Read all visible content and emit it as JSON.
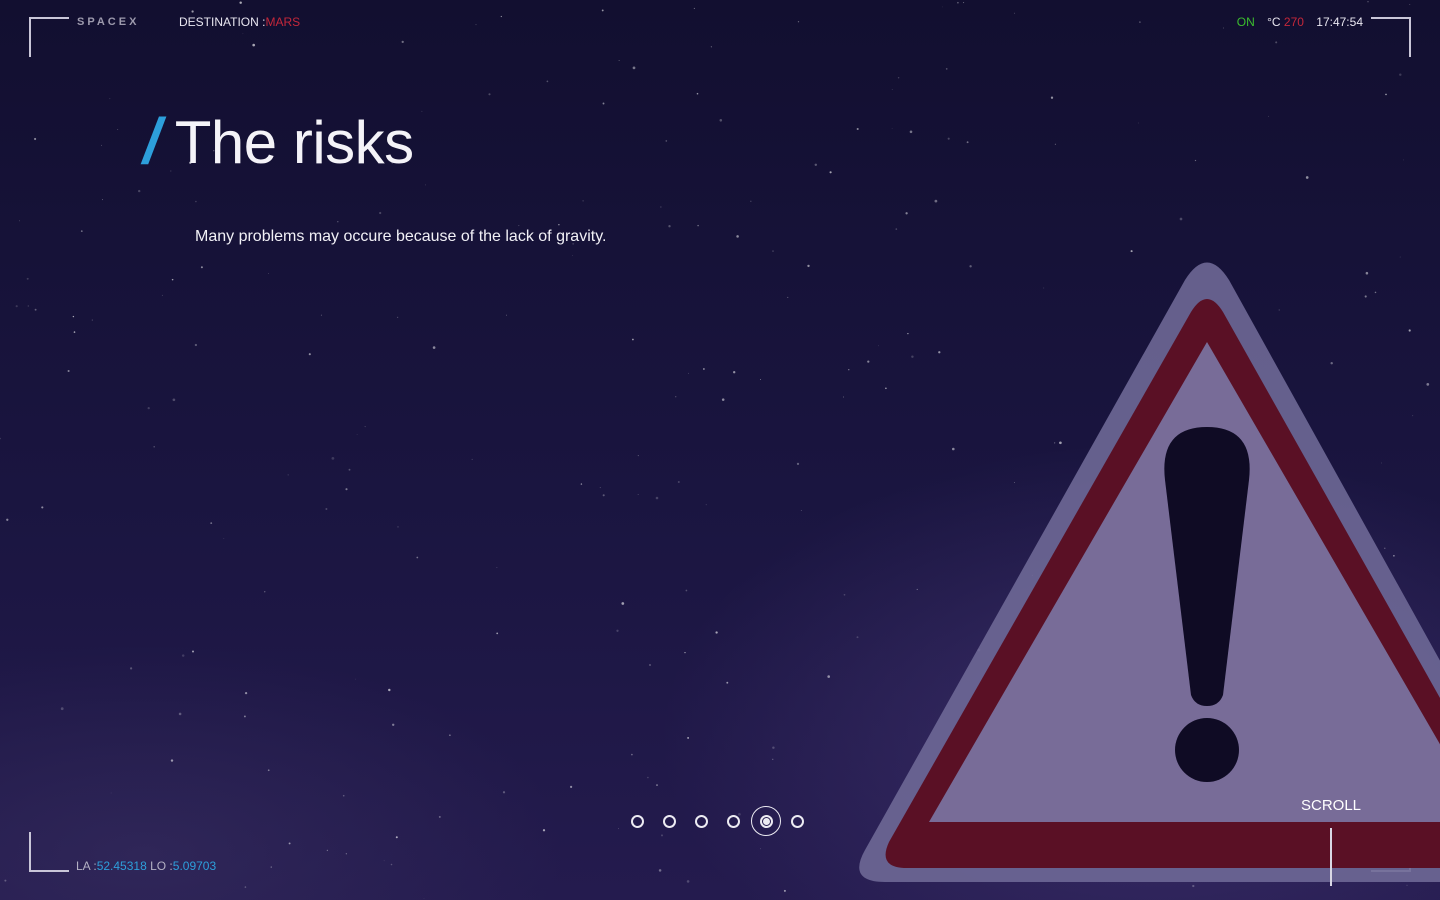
{
  "header": {
    "brand": "SPACEX",
    "destination_label": "DESTINATION :",
    "destination_value": "MARS",
    "status_on": "ON",
    "temperature_unit": "°C",
    "temperature_value": "270",
    "clock": "17:47:54"
  },
  "main": {
    "title_slash": "/",
    "title": "The risks",
    "lead": "Many problems may occure because of the lack of gravity."
  },
  "pager": {
    "total": 6,
    "active_index": 4
  },
  "scroll": {
    "label": "SCROLL"
  },
  "footer": {
    "la_label": "LA :",
    "la_value": "52.45318",
    "lo_label": "LO :",
    "lo_value": "5.09703"
  },
  "colors": {
    "accent_blue": "#2d9fdb",
    "alert_red": "#c4273a",
    "status_green": "#3bbd2e",
    "warning_sign_red": "#7a1330"
  },
  "icons": {
    "warning": "warning-triangle-icon"
  }
}
